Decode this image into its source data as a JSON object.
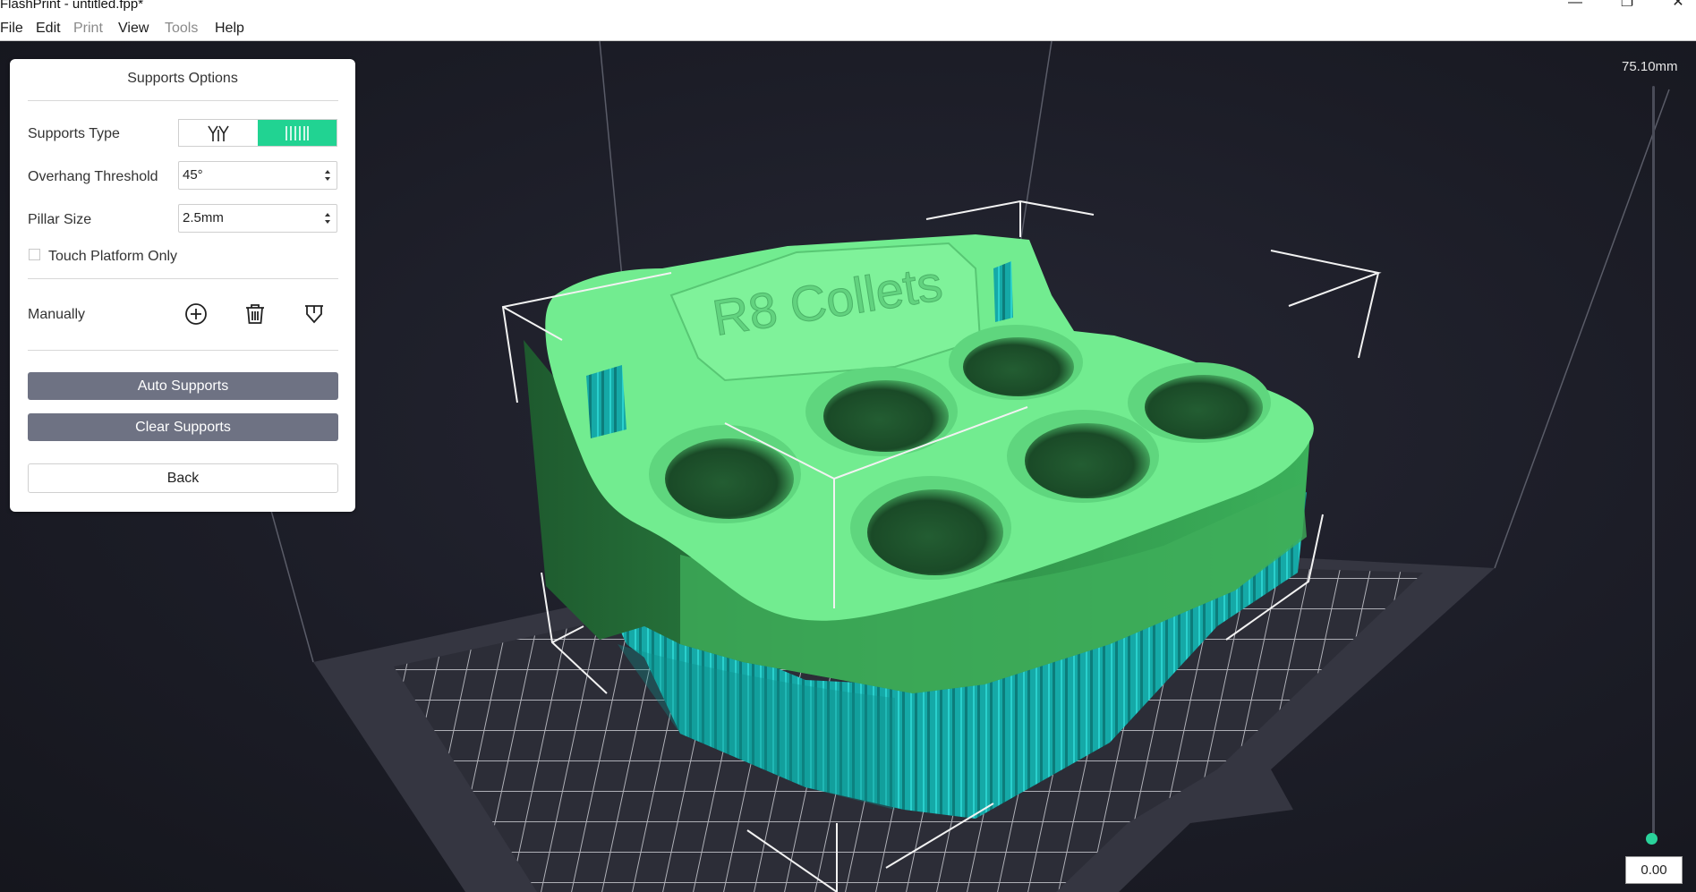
{
  "window": {
    "title": "FlashPrint - untitled.fpp*",
    "controls": [
      "minimize-icon",
      "restore-icon",
      "close-icon"
    ]
  },
  "menu": {
    "file": "File",
    "edit": "Edit",
    "print": "Print",
    "view": "View",
    "tools": "Tools",
    "help": "Help"
  },
  "panel": {
    "title": "Supports Options",
    "supports_type_label": "Supports Type",
    "supports_type_options": [
      "tree-supports-icon",
      "linear-supports-icon"
    ],
    "supports_type_selected": "linear-supports-icon",
    "overhang_label": "Overhang Threshold",
    "overhang_value": "45°",
    "pillar_label": "Pillar Size",
    "pillar_value": "2.5mm",
    "touch_platform_label": "Touch Platform Only",
    "touch_platform_checked": false,
    "manually_label": "Manually",
    "manual_tools": [
      "add-support-icon",
      "delete-support-icon",
      "edit-support-icon"
    ],
    "auto_supports": "Auto Supports",
    "clear_supports": "Clear Supports",
    "back": "Back"
  },
  "model": {
    "embossed_text": "R8 Collets",
    "colors": {
      "model": "#6fe88d",
      "model_shadow": "#2e8b45",
      "supports": "#17b9b6",
      "accent": "#21d392",
      "background": "#1b1c25"
    }
  },
  "zslider": {
    "max_label": "75.10mm",
    "value": "0.00"
  }
}
